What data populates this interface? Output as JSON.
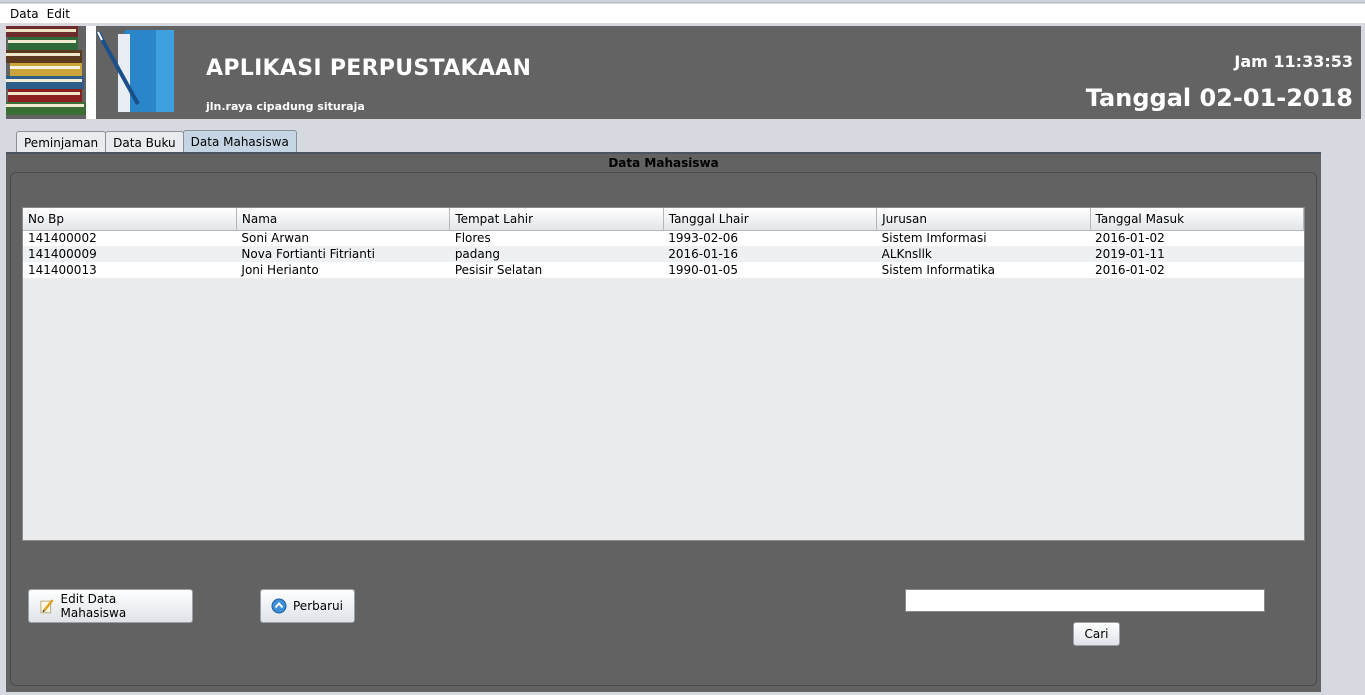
{
  "menu": {
    "items": [
      "Data",
      "Edit"
    ]
  },
  "header": {
    "title": "APLIKASI PERPUSTAKAAN",
    "address": "jln.raya cipadung situraja",
    "clock": "Jam 11:33:53",
    "date": "Tanggal 02-01-2018"
  },
  "tabs": [
    {
      "label": "Peminjaman",
      "active": false
    },
    {
      "label": "Data Buku",
      "active": false
    },
    {
      "label": "Data Mahasiswa",
      "active": true
    }
  ],
  "panel": {
    "title": "Data Mahasiswa"
  },
  "table": {
    "columns": [
      "No Bp",
      "Nama",
      "Tempat Lahir",
      "Tanggal Lhair",
      "Jurusan",
      "Tanggal Masuk"
    ],
    "rows": [
      [
        "141400002",
        "Soni Arwan",
        "Flores",
        "1993-02-06",
        "Sistem Imformasi",
        "2016-01-02"
      ],
      [
        "141400009",
        "Nova Fortianti Fitrianti",
        "padang",
        "2016-01-16",
        "ALKnsllk",
        "2019-01-11"
      ],
      [
        "141400013",
        "Joni Herianto",
        "Pesisir Selatan",
        "1990-01-05",
        "Sistem Informatika",
        "2016-01-02"
      ]
    ]
  },
  "actions": {
    "edit_label": "Edit Data Mahasiswa",
    "refresh_label": "Perbarui",
    "search_value": "",
    "search_button_label": "Cari"
  },
  "colors": {
    "banner": "#636363",
    "panel": "#626262",
    "active_tab": "#c6d5e4",
    "background": "#d6d9df"
  }
}
